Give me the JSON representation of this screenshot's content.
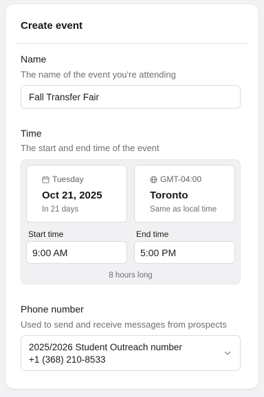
{
  "form": {
    "title": "Create event",
    "name_section": {
      "label": "Name",
      "description": "The name of the event you're attending",
      "value": "Fall Transfer Fair"
    },
    "time_section": {
      "label": "Time",
      "description": "The start and end time of the event",
      "date_card": {
        "weekday": "Tuesday",
        "date": "Oct 21, 2025",
        "relative": "In 21 days",
        "icon": "calendar-icon"
      },
      "timezone_card": {
        "offset": "GMT-04:00",
        "city": "Toronto",
        "note": "Same as local time",
        "icon": "globe-icon"
      },
      "start_label": "Start time",
      "start_value": "9:00 AM",
      "end_label": "End time",
      "end_value": "5:00 PM",
      "duration": "8 hours long"
    },
    "phone_section": {
      "label": "Phone number",
      "description": "Used to send and receive messages from prospects",
      "selected_name": "2025/2026 Student Outreach number",
      "selected_number": "+1 (368) 210-8533",
      "icon": "chevron-down-icon"
    }
  }
}
